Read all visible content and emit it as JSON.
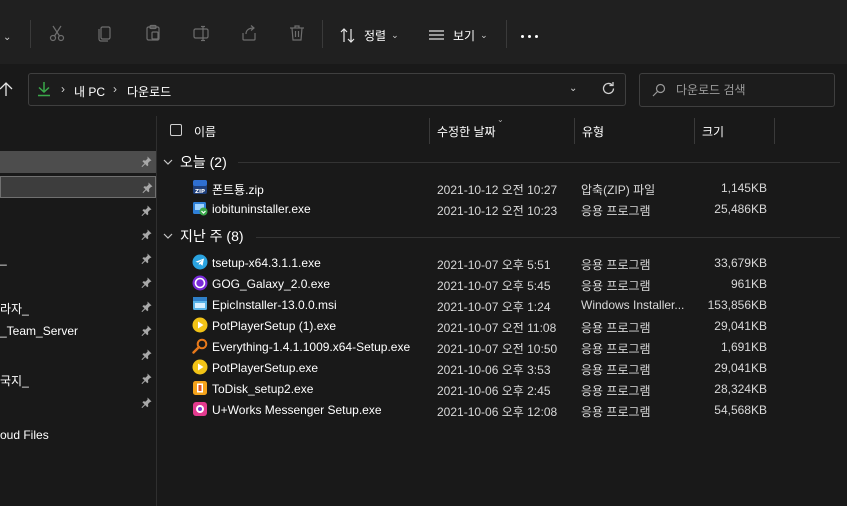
{
  "toolbar": {
    "sort_label": "정렬",
    "view_label": "보기"
  },
  "address": {
    "crumbs": [
      "내 PC",
      "다운로드"
    ],
    "search_placeholder": "다운로드 검색"
  },
  "sidebar": {
    "items": [
      {
        "label": ""
      },
      {
        "label": ""
      },
      {
        "label": ""
      },
      {
        "label": ""
      },
      {
        "label": "_"
      },
      {
        "label": "라자_"
      },
      {
        "label": "_Team_Server"
      },
      {
        "label": ""
      },
      {
        "label": "국지_"
      },
      {
        "label": ""
      },
      {
        "label": "oud Files"
      }
    ]
  },
  "columns": {
    "name": "이름",
    "modified": "수정한 날짜",
    "type": "유형",
    "size": "크기"
  },
  "groups": [
    {
      "label": "오늘 (2)",
      "files": [
        {
          "name": "폰트툥.zip",
          "date": "2021-10-12 오전 10:27",
          "type": "압축(ZIP) 파일",
          "size": "1,145KB",
          "icon": "zip-icon"
        },
        {
          "name": "iobituninstaller.exe",
          "date": "2021-10-12 오전 10:23",
          "type": "응용 프로그램",
          "size": "25,486KB",
          "icon": "installer-icon"
        }
      ]
    },
    {
      "label": "지난 주 (8)",
      "files": [
        {
          "name": "tsetup-x64.3.1.1.exe",
          "date": "2021-10-07 오후 5:51",
          "type": "응용 프로그램",
          "size": "33,679KB",
          "icon": "telegram-icon"
        },
        {
          "name": "GOG_Galaxy_2.0.exe",
          "date": "2021-10-07 오후 5:45",
          "type": "응용 프로그램",
          "size": "961KB",
          "icon": "gog-icon"
        },
        {
          "name": "EpicInstaller-13.0.0.msi",
          "date": "2021-10-07 오후 1:24",
          "type": "Windows Installer...",
          "size": "153,856KB",
          "icon": "msi-icon"
        },
        {
          "name": "PotPlayerSetup (1).exe",
          "date": "2021-10-07 오전 11:08",
          "type": "응용 프로그램",
          "size": "29,041KB",
          "icon": "potplayer-icon"
        },
        {
          "name": "Everything-1.4.1.1009.x64-Setup.exe",
          "date": "2021-10-07 오전 10:50",
          "type": "응용 프로그램",
          "size": "1,691KB",
          "icon": "everything-icon"
        },
        {
          "name": "PotPlayerSetup.exe",
          "date": "2021-10-06 오후 3:53",
          "type": "응용 프로그램",
          "size": "29,041KB",
          "icon": "potplayer-icon"
        },
        {
          "name": "ToDisk_setup2.exe",
          "date": "2021-10-06 오후 2:45",
          "type": "응용 프로그램",
          "size": "28,324KB",
          "icon": "todisk-icon"
        },
        {
          "name": "U+Works Messenger Setup.exe",
          "date": "2021-10-06 오후 12:08",
          "type": "응용 프로그램",
          "size": "54,568KB",
          "icon": "uworks-icon"
        }
      ]
    }
  ],
  "colors": {
    "background": "#191919",
    "toolbar": "#202020",
    "accent_download": "#3aa84a"
  }
}
